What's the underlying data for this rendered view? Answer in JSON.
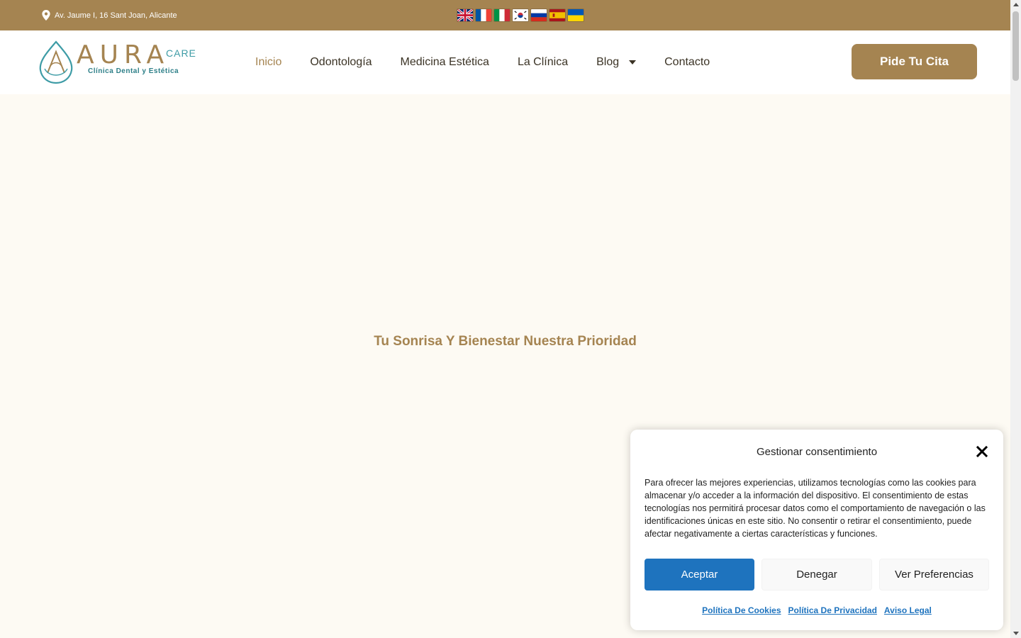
{
  "topbar": {
    "address": "Av. Jaume I, 16 Sant Joan, Alicante",
    "address_icon": "map-pin-icon",
    "languages": [
      {
        "code": "en",
        "name": "English"
      },
      {
        "code": "fr",
        "name": "Français"
      },
      {
        "code": "it",
        "name": "Italiano"
      },
      {
        "code": "ko",
        "name": "한국어"
      },
      {
        "code": "ru",
        "name": "Русский"
      },
      {
        "code": "es",
        "name": "Español"
      },
      {
        "code": "uk",
        "name": "Українська"
      }
    ]
  },
  "header": {
    "logo": {
      "main": "AURA",
      "secondary": "CARE",
      "tagline": "Clínica Dental y Estética"
    },
    "nav": [
      {
        "label": "Inicio",
        "active": true
      },
      {
        "label": "Odontología"
      },
      {
        "label": "Medicina Estética"
      },
      {
        "label": "La Clínica"
      },
      {
        "label": "Blog",
        "has_dropdown": true
      },
      {
        "label": "Contacto"
      }
    ],
    "cta_label": "Pide Tu Cita"
  },
  "hero": {
    "title": "Tu Sonrisa Y Bienestar Nuestra Prioridad"
  },
  "cookie_modal": {
    "title": "Gestionar consentimiento",
    "body": "Para ofrecer las mejores experiencias, utilizamos tecnologías como las cookies para almacenar y/o acceder a la información del dispositivo. El consentimiento de estas tecnologías nos permitirá procesar datos como el comportamiento de navegación o las identificaciones únicas en este sitio. No consentir o retirar el consentimiento, puede afectar negativamente a ciertas características y funciones.",
    "accept_label": "Aceptar",
    "deny_label": "Denegar",
    "prefs_label": "Ver Preferencias",
    "links": [
      "Política De Cookies",
      "Política De Privacidad",
      "Aviso Legal"
    ]
  },
  "colors": {
    "brand": "#A58451",
    "teal": "#3E9CA6",
    "accent_blue": "#1E73BE",
    "background": "#FDFAF3"
  }
}
